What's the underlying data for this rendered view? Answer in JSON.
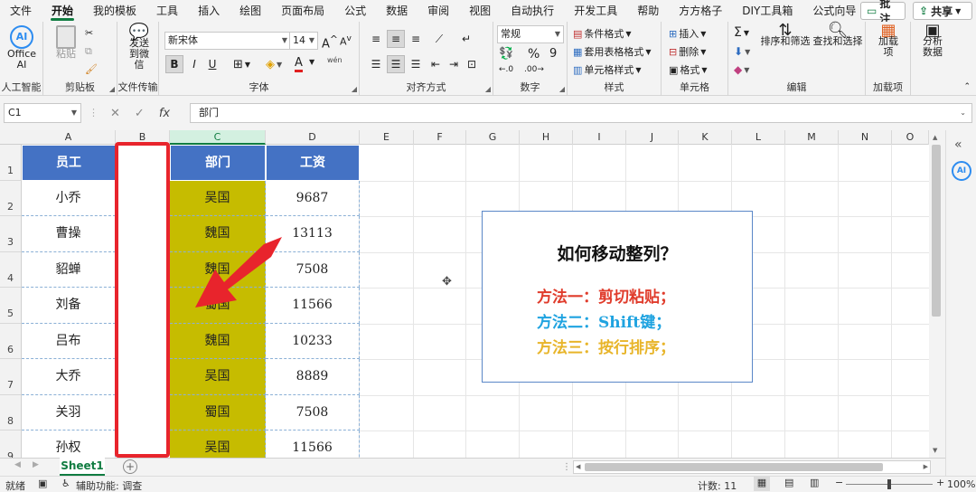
{
  "menu": {
    "tabs": [
      "文件",
      "开始",
      "我的模板",
      "工具",
      "插入",
      "绘图",
      "页面布局",
      "公式",
      "数据",
      "审阅",
      "视图",
      "自动执行",
      "开发工具",
      "帮助",
      "方方格子",
      "DIY工具箱",
      "公式向导"
    ],
    "active_index": 1,
    "comment_label": "批注",
    "share_label": "共享"
  },
  "ribbon": {
    "office_ai_label": "Office AI",
    "paste_label": "粘贴",
    "send_wechat_label": "发送到微信",
    "font_name": "新宋体",
    "font_size": "14",
    "bold_label": "B",
    "italic_label": "I",
    "underline_label": "U",
    "font_color_label": "A",
    "phonetic_label": "wén",
    "number_format": "常规",
    "percent_label": "%",
    "comma_label": "9",
    "cond_format_label": "条件格式",
    "table_format_label": "套用表格格式",
    "cell_style_label": "单元格样式",
    "insert_label": "插入",
    "delete_label": "删除",
    "format_label": "格式",
    "sort_filter_label": "排序和筛选",
    "find_select_label": "查找和选择",
    "addin_label": "加载项",
    "analyze_label": "分析数据",
    "groups": {
      "ai": "人工智能",
      "clipboard": "剪贴板",
      "transfer": "文件传输",
      "font": "字体",
      "align": "对齐方式",
      "number": "数字",
      "styles": "样式",
      "cells": "单元格",
      "edit": "编辑",
      "addins": "加载项"
    }
  },
  "formula_bar": {
    "name_box": "C1",
    "fx_label": "fx",
    "content": "部门"
  },
  "columns": [
    "A",
    "B",
    "C",
    "D",
    "E",
    "F",
    "G",
    "H",
    "I",
    "J",
    "K",
    "L",
    "M",
    "N",
    "O"
  ],
  "rows": [
    "1",
    "2",
    "3",
    "4",
    "5",
    "6",
    "7",
    "8",
    "9"
  ],
  "table": {
    "headers": {
      "employee": "员工",
      "department": "部门",
      "salary": "工资"
    },
    "records": [
      {
        "employee": "小乔",
        "department": "吴国",
        "salary": "9687"
      },
      {
        "employee": "曹操",
        "department": "魏国",
        "salary": "13113"
      },
      {
        "employee": "貂蝉",
        "department": "魏国",
        "salary": "7508"
      },
      {
        "employee": "刘备",
        "department": "蜀国",
        "salary": "11566"
      },
      {
        "employee": "吕布",
        "department": "魏国",
        "salary": "10233"
      },
      {
        "employee": "大乔",
        "department": "吴国",
        "salary": "8889"
      },
      {
        "employee": "关羽",
        "department": "蜀国",
        "salary": "7508"
      },
      {
        "employee": "孙权",
        "department": "吴国",
        "salary": "11566"
      }
    ]
  },
  "textbox": {
    "title": "如何移动整列？",
    "lines": [
      {
        "text": "方法一：剪切粘贴；",
        "color": "#e03c2c"
      },
      {
        "text": "方法二：Shift键；",
        "color": "#1fa3e0"
      },
      {
        "text": "方法三：按行排序；",
        "color": "#e8b52a"
      }
    ]
  },
  "colors": {
    "accent": "#107c41",
    "header_fill": "#4472c4",
    "dept_fill": "#c6bc00",
    "highlight": "#e8242c"
  },
  "sheet_tab": "Sheet1",
  "status": {
    "ready": "就绪",
    "accessibility": "辅助功能: 调查",
    "count": "计数: 11",
    "zoom": "100%"
  }
}
